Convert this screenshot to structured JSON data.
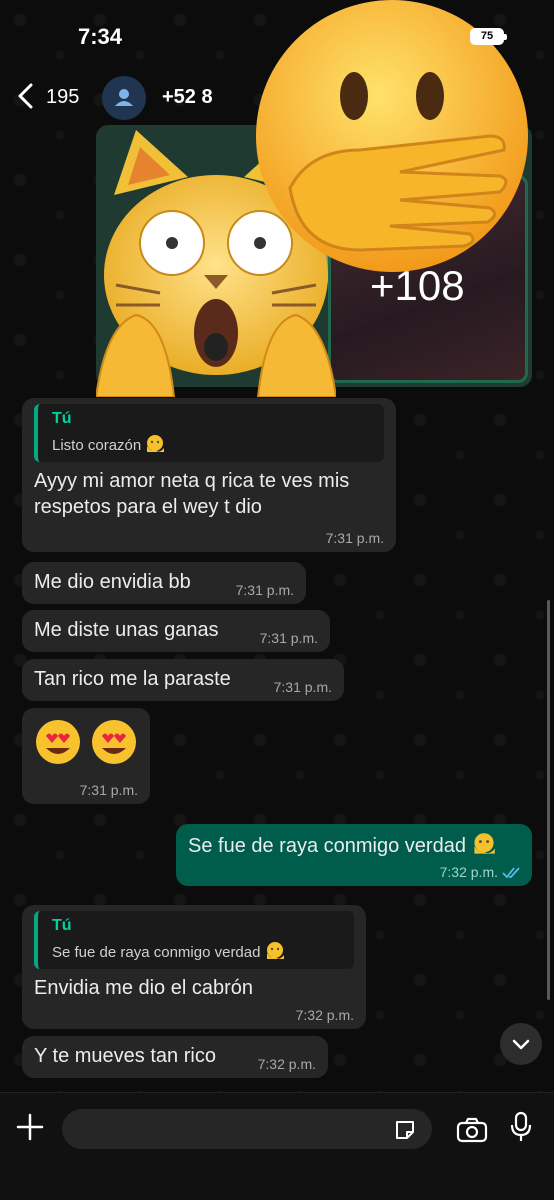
{
  "status_bar": {
    "time": "7:34",
    "battery": "75"
  },
  "header": {
    "back_count": "195",
    "contact_name": "+52 8"
  },
  "media": {
    "more_count": "+108"
  },
  "messages": [
    {
      "quote_author": "Tú",
      "quote_text": "Listo corazón",
      "text": "Ayyy mi amor neta q rica te ves mis respetos para el wey t dio",
      "time": "7:31 p.m."
    },
    {
      "text": "Me dio envidia bb",
      "time": "7:31 p.m."
    },
    {
      "text": "Me diste unas ganas",
      "time": "7:31 p.m."
    },
    {
      "text": "Tan rico me la paraste",
      "time": "7:31 p.m."
    },
    {
      "text": "😍 😍",
      "time": "7:31 p.m."
    },
    {
      "text": "Se fue de raya conmigo verdad",
      "time": "7:32 p.m."
    },
    {
      "quote_author": "Tú",
      "quote_text": "Se fue de raya conmigo verdad",
      "text": "Envidia me dio el cabrón",
      "time": "7:32 p.m."
    },
    {
      "text": "Y te mueves tan rico",
      "time": "7:32 p.m."
    }
  ],
  "icons": [
    "back-chevron-icon",
    "person-icon",
    "plus-icon",
    "sticker-icon",
    "camera-icon",
    "microphone-icon",
    "chevron-down-icon",
    "double-check-icon",
    "melting-face-icon",
    "heart-eyes-icon"
  ],
  "colors": {
    "incoming_bubble": "#262626",
    "outgoing_bubble": "#005c4b",
    "quote_accent": "#06cf9c",
    "read_ticks": "#53bdeb"
  }
}
